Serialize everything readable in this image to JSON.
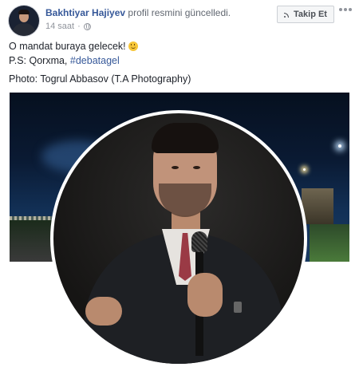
{
  "post": {
    "author": "Bakhtiyar Hajiyev",
    "action": "profil resmini güncelledi.",
    "time": "14 saat",
    "follow_label": "Takip Et",
    "line1": "O mandat buraya gelecek!",
    "line2_prefix": "P.S: Qorxma, ",
    "hashtag": "#debatagel",
    "line3": "Photo: Togrul Abbasov (T.A Photography)"
  },
  "icons": {
    "privacy": "globe-icon",
    "follow": "rss-icon",
    "menu": "more-icon",
    "emoji": "smiley-icon"
  },
  "colors": {
    "link": "#365899",
    "meta": "#90949c"
  }
}
